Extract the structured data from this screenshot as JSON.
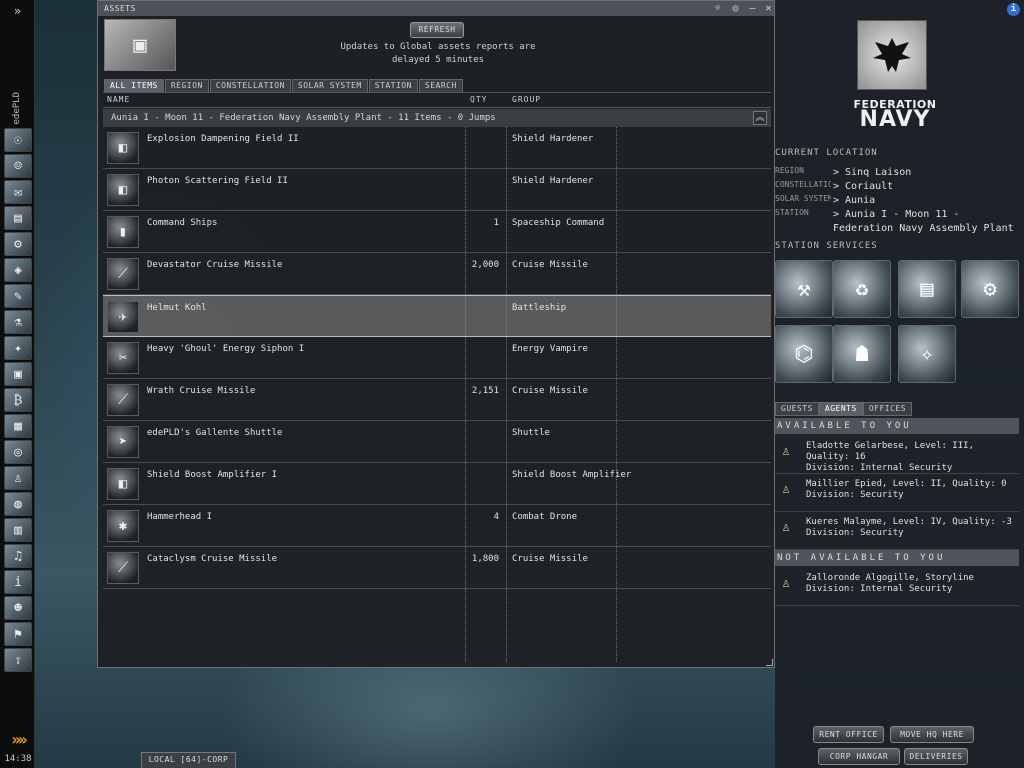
{
  "sidebar": {
    "expand_icon": "»",
    "pilot_name": "edePLD",
    "icons": [
      {
        "name": "character-sheet-icon",
        "glyph": "☉"
      },
      {
        "name": "people-icon",
        "glyph": "☺"
      },
      {
        "name": "mail-icon",
        "glyph": "✉"
      },
      {
        "name": "notepad-icon",
        "glyph": "▤"
      },
      {
        "name": "fitting-icon",
        "glyph": "⚙"
      },
      {
        "name": "map-icon",
        "glyph": "◈"
      },
      {
        "name": "journal-icon",
        "glyph": "✎"
      },
      {
        "name": "science-icon",
        "glyph": "⚗"
      },
      {
        "name": "ship-icon",
        "glyph": "✦"
      },
      {
        "name": "assets-icon",
        "glyph": "▣"
      },
      {
        "name": "market-icon",
        "glyph": "₿"
      },
      {
        "name": "calculator-icon",
        "glyph": "▦"
      },
      {
        "name": "help-lifebuoy-icon",
        "glyph": "◎"
      },
      {
        "name": "agents-icon",
        "glyph": "♙"
      },
      {
        "name": "browser-icon",
        "glyph": "◍"
      },
      {
        "name": "news-icon",
        "glyph": "▥"
      },
      {
        "name": "audio-icon",
        "glyph": "♫"
      },
      {
        "name": "info-icon",
        "glyph": "i"
      },
      {
        "name": "portrait-icon",
        "glyph": "☻"
      },
      {
        "name": "fleet-icon",
        "glyph": "⚑"
      },
      {
        "name": "undock-icon",
        "glyph": "⇪"
      }
    ],
    "autopilot_icon": "»»",
    "clock": "14:38"
  },
  "assets_window": {
    "title": "ASSETS",
    "controls": [
      "☼",
      "◎",
      "–",
      "✕"
    ],
    "refresh_label": "REFRESH",
    "note": "Updates to Global assets reports are delayed 5 minutes",
    "tabs": [
      "ALL ITEMS",
      "REGION",
      "CONSTELLATION",
      "SOLAR SYSTEM",
      "STATION",
      "SEARCH"
    ],
    "columns": {
      "name": "NAME",
      "qty": "QTY",
      "group": "GROUP"
    },
    "location_header": "Aunia I - Moon 11 - Federation Navy Assembly Plant - 11 Items - 0 Jumps",
    "collapse_icon": "︽",
    "items": [
      {
        "name": "Explosion Dampening Field II",
        "qty": "",
        "group": "Shield Hardener",
        "icon": "shield-hardener-icon",
        "glyph": "◧"
      },
      {
        "name": "Photon Scattering Field II",
        "qty": "",
        "group": "Shield Hardener",
        "icon": "shield-hardener-icon",
        "glyph": "◧"
      },
      {
        "name": "Command Ships",
        "qty": "1",
        "group": "Spaceship Command",
        "icon": "skillbook-icon",
        "glyph": "▮"
      },
      {
        "name": "Devastator Cruise Missile",
        "qty": "2,000",
        "group": "Cruise Missile",
        "icon": "missile-icon",
        "glyph": "⟋"
      },
      {
        "name": "Helmut Kohl",
        "qty": "",
        "group": "Battleship",
        "icon": "battleship-icon",
        "glyph": "✈"
      },
      {
        "name": "Heavy 'Ghoul' Energy Siphon I",
        "qty": "",
        "group": "Energy Vampire",
        "icon": "energy-vampire-icon",
        "glyph": "✂"
      },
      {
        "name": "Wrath Cruise Missile",
        "qty": "2,151",
        "group": "Cruise Missile",
        "icon": "missile-icon",
        "glyph": "⟋"
      },
      {
        "name": "edePLD's Gallente Shuttle",
        "qty": "",
        "group": "Shuttle",
        "icon": "shuttle-icon",
        "glyph": "➤"
      },
      {
        "name": "Shield Boost Amplifier I",
        "qty": "",
        "group": "Shield Boost Amplifier",
        "icon": "shield-amplifier-icon",
        "glyph": "◧"
      },
      {
        "name": "Hammerhead I",
        "qty": "4",
        "group": "Combat Drone",
        "icon": "drone-icon",
        "glyph": "✱"
      },
      {
        "name": "Cataclysm Cruise Missile",
        "qty": "1,800",
        "group": "Cruise Missile",
        "icon": "missile-icon",
        "glyph": "⟋"
      }
    ]
  },
  "station_panel": {
    "info_icon": "i",
    "logo_line1": "FEDERATION",
    "logo_line2": "NAVY",
    "current_location_header": "CURRENT LOCATION",
    "location": [
      {
        "key": "REGION",
        "value": "> Sinq Laison"
      },
      {
        "key": "CONSTELLATION",
        "value": "> Coriault"
      },
      {
        "key": "SOLAR SYSTEM",
        "value": "> Aunia"
      },
      {
        "key": "STATION",
        "value": "> Aunia I - Moon 11 - Federation Navy Assembly Plant"
      }
    ],
    "services_header": "STATION SERVICES",
    "services": [
      {
        "name": "repair-shop-icon",
        "glyph": "⚒"
      },
      {
        "name": "reprocessing-plant-icon",
        "glyph": "♻"
      },
      {
        "name": "market-service-icon",
        "glyph": "▤"
      },
      {
        "name": "factory-icon",
        "glyph": "⚙"
      },
      {
        "name": "laboratory-icon",
        "glyph": "⌬"
      },
      {
        "name": "clone-bay-icon",
        "glyph": "☗"
      },
      {
        "name": "fitting-service-icon",
        "glyph": "✧"
      }
    ],
    "tabs": [
      "GUESTS",
      "AGENTS",
      "OFFICES"
    ],
    "available_header": "AVAILABLE TO YOU",
    "agents_available": [
      {
        "line1": "Eladotte Gelarbese, Level: III, Quality: 16",
        "line2": "Division: Internal Security"
      },
      {
        "line1": "Maillier Epied, Level: II, Quality: 0",
        "line2": "Division: Security"
      },
      {
        "line1": "Kueres Malayme, Level: IV, Quality: -3",
        "line2": "Division: Security"
      }
    ],
    "not_available_header": "NOT AVAILABLE TO YOU",
    "agents_unavailable": [
      {
        "line1": "Zalloronde Algogille, Storyline",
        "line2": "Division: Internal Security"
      }
    ],
    "buttons": {
      "rent_office": "RENT OFFICE",
      "move_hq": "MOVE HQ HERE",
      "corp_hangar": "CORP HANGAR",
      "deliveries": "DELIVERIES"
    }
  },
  "chat_tab": "LOCAL [64]-CORP"
}
